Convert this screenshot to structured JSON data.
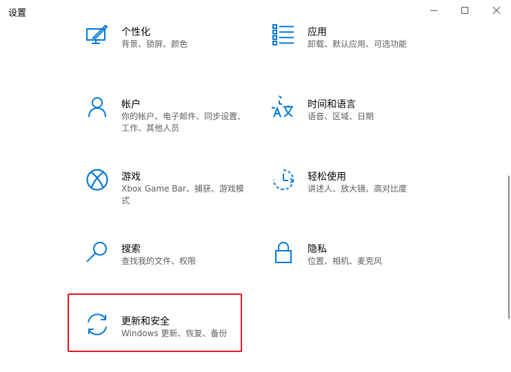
{
  "window": {
    "title": "设置",
    "controls": {
      "minimize": "minimize-icon",
      "maximize": "maximize-icon",
      "close": "close-icon"
    }
  },
  "accent_color": "#0078d7",
  "highlight_color": "#e81123",
  "tiles": [
    {
      "name": "个性化",
      "desc": "背景、锁屏、颜色",
      "icon": "personalization-icon"
    },
    {
      "name": "应用",
      "desc": "卸载、默认应用、可选功能",
      "icon": "apps-icon"
    },
    {
      "name": "帐户",
      "desc": "你的帐户、电子邮件、同步设置、工作、其他人员",
      "icon": "account-icon"
    },
    {
      "name": "时间和语言",
      "desc": "语音、区域、日期",
      "icon": "time-language-icon"
    },
    {
      "name": "游戏",
      "desc": "Xbox Game Bar、捕获、游戏模式",
      "icon": "xbox-icon"
    },
    {
      "name": "轻松使用",
      "desc": "讲述人、放大镜、高对比度",
      "icon": "ease-of-access-icon"
    },
    {
      "name": "搜索",
      "desc": "查找我的文件、权限",
      "icon": "search-icon"
    },
    {
      "name": "隐私",
      "desc": "位置、相机、麦克风",
      "icon": "lock-icon"
    },
    {
      "name": "更新和安全",
      "desc": "Windows 更新、恢复、备份",
      "icon": "update-sync-icon",
      "highlighted": true
    }
  ]
}
